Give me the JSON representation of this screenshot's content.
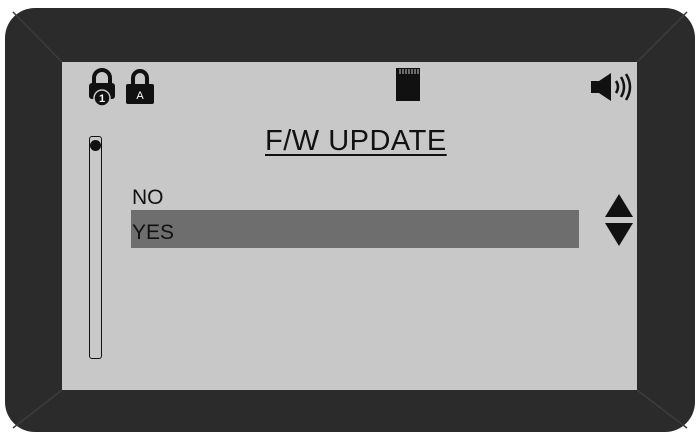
{
  "screen": {
    "title": "F/W UPDATE",
    "status_icons": [
      "lock-1-icon",
      "lock-a-icon",
      "sd-card-icon",
      "speaker-volume-icon"
    ],
    "lock_labels": {
      "lock1": "1",
      "lockA": "A"
    },
    "menu": {
      "options": [
        "NO",
        "YES"
      ],
      "selected": "YES"
    },
    "scroll_position": 0
  },
  "colors": {
    "bezel": "#2b2b2b",
    "screen": "#c8c8c8",
    "highlight": "#6e6e6e",
    "text": "#111111"
  }
}
